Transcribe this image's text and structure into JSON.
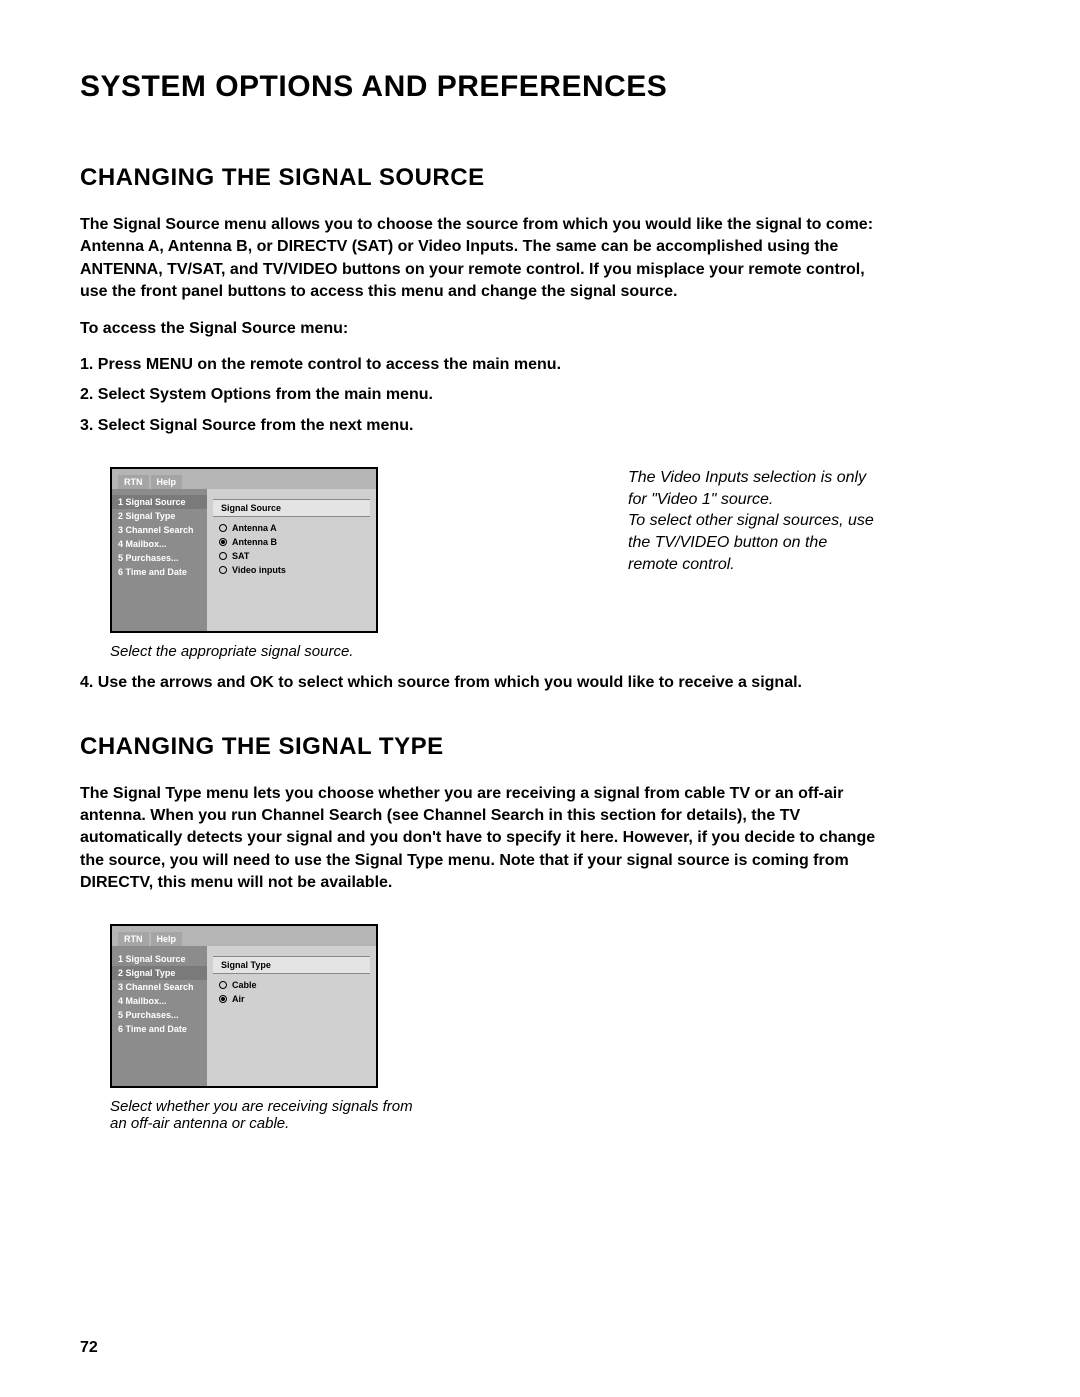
{
  "page_title": "SYSTEM OPTIONS AND PREFERENCES",
  "section1": {
    "heading": "CHANGING THE SIGNAL SOURCE",
    "intro": "The Signal Source menu allows you to choose the source from which you would like the signal to come: Antenna A, Antenna B, or DIRECTV (SAT) or Video Inputs. The same can be accomplished using the ANTENNA, TV/SAT, and TV/VIDEO buttons on your remote control. If you misplace your remote control, use the front panel buttons to access this menu and change the signal source.",
    "access_lead": "To access the Signal Source menu:",
    "steps": [
      "1.  Press MENU on the remote control to access the main menu.",
      "2.  Select System Options from the main menu.",
      "3.  Select Signal Source from the next menu."
    ],
    "step4": "4.  Use the arrows and OK to select which source from which you would like to receive a signal.",
    "caption": "Select the appropriate signal source.",
    "sidenote1": "The Video Inputs selection is only for \"Video 1\" source.",
    "sidenote2": "To select other signal sources, use the TV/VIDEO button on the remote control."
  },
  "section2": {
    "heading": "CHANGING THE SIGNAL TYPE",
    "intro": "The Signal Type menu lets you choose whether you are receiving a signal from cable TV or an off-air antenna. When you run Channel Search (see Channel Search in this section for details), the TV automatically detects your signal and you don't have to specify it here. However, if you decide to change the source, you will need to use the Signal Type menu. Note that if your signal source is coming from DIRECTV, this menu will not be available.",
    "caption": "Select whether you are receiving signals from an off-air antenna or cable."
  },
  "menu": {
    "tabs": {
      "rtn": "RTN",
      "help": "Help"
    },
    "sidebar": [
      "1 Signal Source",
      "2 Signal Type",
      "3 Channel Search",
      "4 Mailbox...",
      "5 Purchases...",
      "6 Time and Date"
    ],
    "panel1": {
      "title": "Signal Source",
      "opts": [
        "Antenna A",
        "Antenna B",
        "SAT",
        "Video inputs"
      ]
    },
    "panel2": {
      "title": "Signal Type",
      "opts": [
        "Cable",
        "Air"
      ]
    }
  },
  "page_number": "72"
}
